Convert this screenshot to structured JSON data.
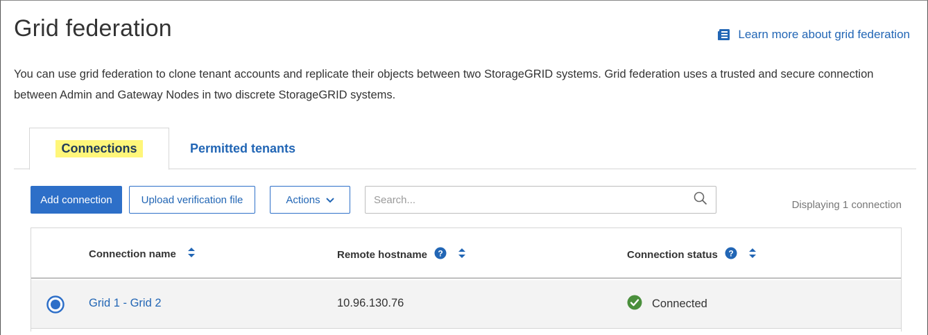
{
  "page": {
    "title": "Grid federation",
    "learn_more": "Learn more about grid federation",
    "description": "You can use grid federation to clone tenant accounts and replicate their objects between two StorageGRID systems. Grid federation uses a trusted and secure connection between Admin and Gateway Nodes in two discrete StorageGRID systems."
  },
  "tabs": [
    {
      "label": "Connections",
      "active": true
    },
    {
      "label": "Permitted tenants",
      "active": false
    }
  ],
  "toolbar": {
    "add_label": "Add connection",
    "upload_label": "Upload verification file",
    "actions_label": "Actions",
    "search_placeholder": "Search...",
    "displaying": "Displaying 1 connection"
  },
  "table": {
    "columns": [
      "Connection name",
      "Remote hostname",
      "Connection status"
    ],
    "rows": [
      {
        "name": "Grid 1 - Grid 2",
        "hostname": "10.96.130.76",
        "status": "Connected",
        "selected": true
      }
    ]
  },
  "icons": {
    "learn_more": "document-icon",
    "actions": "chevron-down-icon",
    "search": "search-icon",
    "help": "help-circle-icon",
    "sort": "sort-icon",
    "status": "check-circle-icon"
  },
  "colors": {
    "link": "#2266b5",
    "primary": "#2d6fc8",
    "success": "#4a8f3c",
    "tab_highlight": "#fff67a"
  }
}
